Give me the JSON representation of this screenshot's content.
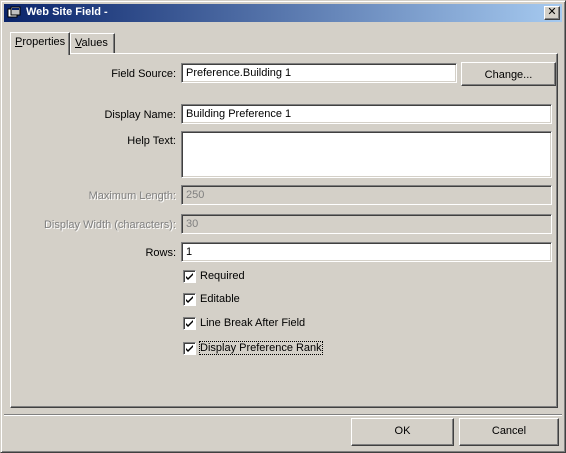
{
  "window": {
    "title": "Web Site Field -"
  },
  "tabs": [
    {
      "label_accel": "P",
      "label_rest": "roperties",
      "active": true
    },
    {
      "label_accel": "V",
      "label_rest": "alues",
      "active": false
    }
  ],
  "form": {
    "field_source": {
      "label": "Field Source:",
      "value": "Preference.Building 1",
      "button": "Change..."
    },
    "display_name": {
      "label": "Display Name:",
      "value": "Building Preference 1"
    },
    "help_text": {
      "label": "Help Text:",
      "value": ""
    },
    "maximum_length": {
      "label": "Maximum Length:",
      "value": "250",
      "disabled": true
    },
    "display_width": {
      "label": "Display Width (characters):",
      "value": "30",
      "disabled": true
    },
    "rows": {
      "label": "Rows:",
      "value": "1"
    }
  },
  "checkboxes": [
    {
      "label": "Required",
      "checked": true
    },
    {
      "label": "Editable",
      "checked": true
    },
    {
      "label": "Line Break After Field",
      "checked": true
    },
    {
      "label": "Display Preference Rank",
      "checked": true,
      "focused": true
    }
  ],
  "footer": {
    "ok_label": "OK",
    "cancel_label": "Cancel"
  }
}
